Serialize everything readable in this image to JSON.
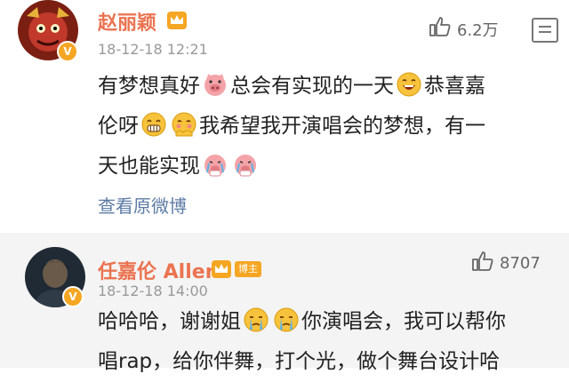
{
  "comments": [
    {
      "username": "赵丽颖",
      "timestamp": "18-12-18 12:21",
      "likes": "6.2万",
      "lines": [
        {
          "segments": [
            {
              "type": "text",
              "value": "有梦想真好"
            },
            {
              "type": "emoji",
              "name": "pig-face-emoji"
            },
            {
              "type": "text",
              "value": "总会有实现的一天"
            },
            {
              "type": "emoji",
              "name": "laugh-emoji"
            },
            {
              "type": "text",
              "value": "恭喜嘉"
            }
          ]
        },
        {
          "segments": [
            {
              "type": "text",
              "value": "伦呀"
            },
            {
              "type": "emoji",
              "name": "grin-emoji"
            },
            {
              "type": "emoji",
              "name": "blush-emoji"
            },
            {
              "type": "text",
              "value": "我希望我开演唱会的梦想，有一"
            }
          ]
        },
        {
          "segments": [
            {
              "type": "text",
              "value": "天也能实现"
            },
            {
              "type": "emoji",
              "name": "pig-cry-emoji"
            },
            {
              "type": "emoji",
              "name": "pig-cry-emoji"
            }
          ]
        }
      ],
      "view_original": "查看原微博"
    },
    {
      "username": "任嘉伦 Allen",
      "badge": "博主",
      "timestamp": "18-12-18 14:00",
      "likes": "8707",
      "lines": [
        {
          "segments": [
            {
              "type": "text",
              "value": "哈哈哈，谢谢姐"
            },
            {
              "type": "emoji",
              "name": "cry-emoji"
            },
            {
              "type": "emoji",
              "name": "cry-emoji"
            },
            {
              "type": "text",
              "value": "你演唱会，我可以帮你"
            }
          ]
        },
        {
          "segments": [
            {
              "type": "text",
              "value": "唱rap，给你伴舞，打个光，做个舞台设计哈"
            }
          ]
        }
      ]
    }
  ],
  "colors": {
    "username": "#eb7350",
    "link": "#5d7ba6",
    "badge_bg": "#f5a623",
    "second_bg": "#f4f4f4"
  },
  "icons": {
    "like": "thumbs-up-icon",
    "reply": "comment-icon",
    "crown": "crown-icon",
    "verified": "verified-v-icon"
  }
}
